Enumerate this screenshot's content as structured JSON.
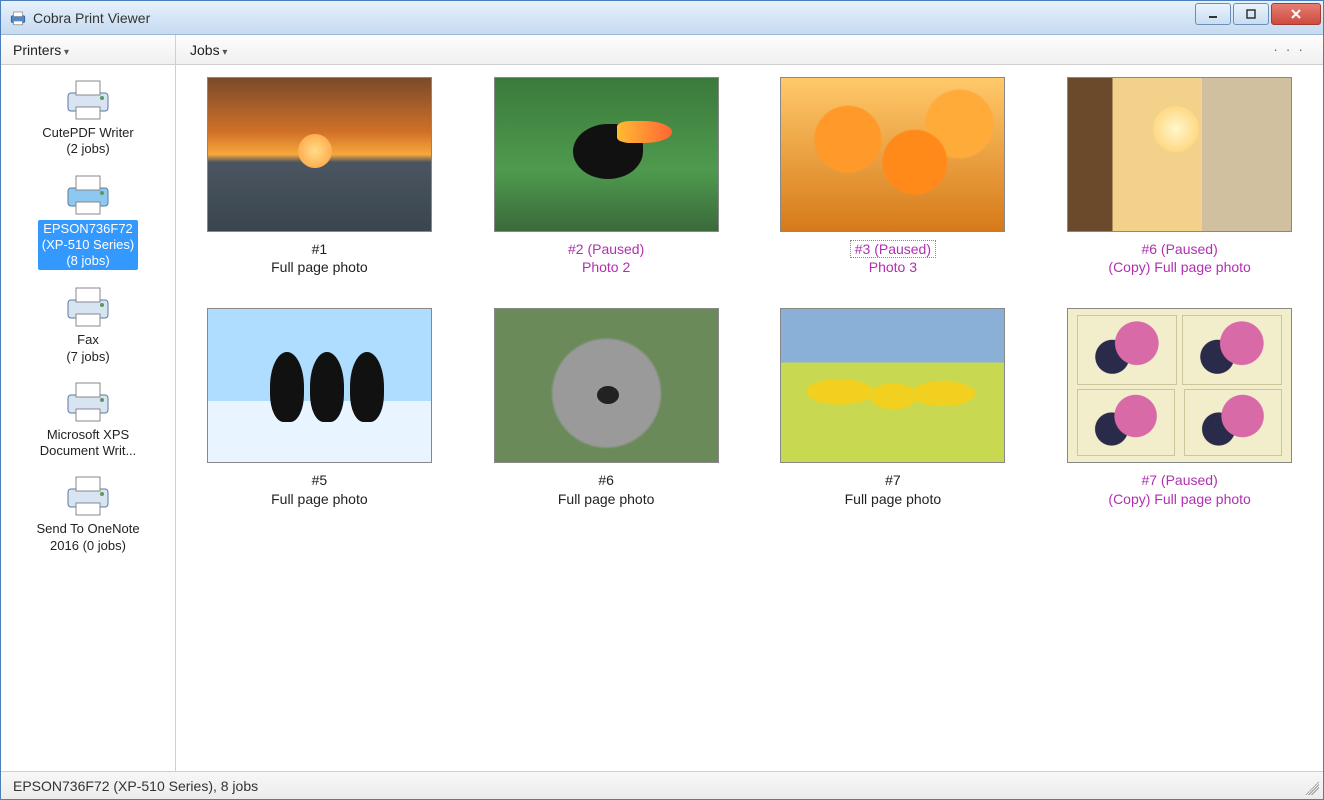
{
  "window": {
    "title": "Cobra Print Viewer"
  },
  "toolbar": {
    "printers_label": "Printers",
    "jobs_label": "Jobs"
  },
  "sidebar": {
    "printers": [
      {
        "name": "CutePDF Writer",
        "jobs_line": "(2 jobs)",
        "selected": false
      },
      {
        "name": "EPSON736F72",
        "name_line2": "(XP-510 Series)",
        "jobs_line": "(8 jobs)",
        "selected": true
      },
      {
        "name": "Fax",
        "jobs_line": "(7 jobs)",
        "selected": false
      },
      {
        "name": "Microsoft XPS",
        "name_line2": "Document Writ...",
        "jobs_line": "",
        "selected": false
      },
      {
        "name": "Send To OneNote",
        "name_line2": "2016 (0 jobs)",
        "jobs_line": "",
        "selected": false
      }
    ]
  },
  "jobs": [
    {
      "num": "#1",
      "title": "Full page photo",
      "paused": false,
      "focused": false,
      "thumb": "t-sunset"
    },
    {
      "num": "#2  (Paused)",
      "title": "Photo 2",
      "paused": true,
      "focused": false,
      "thumb": "t-toucan"
    },
    {
      "num": "#3  (Paused)",
      "title": "Photo 3",
      "paused": true,
      "focused": true,
      "thumb": "t-flowers"
    },
    {
      "num": "#6  (Paused)",
      "title": "(Copy) Full page photo",
      "paused": true,
      "focused": false,
      "thumb": "t-beach"
    },
    {
      "num": "#5",
      "title": "Full page photo",
      "paused": false,
      "focused": false,
      "thumb": "t-penguins"
    },
    {
      "num": "#6",
      "title": "Full page photo",
      "paused": false,
      "focused": false,
      "thumb": "t-koala"
    },
    {
      "num": "#7",
      "title": "Full page photo",
      "paused": false,
      "focused": false,
      "thumb": "t-tulips"
    },
    {
      "num": "#7  (Paused)",
      "title": "(Copy) Full page photo",
      "paused": true,
      "focused": false,
      "thumb": "t-collage"
    }
  ],
  "statusbar": {
    "text": "EPSON736F72 (XP-510 Series),  8 jobs"
  }
}
